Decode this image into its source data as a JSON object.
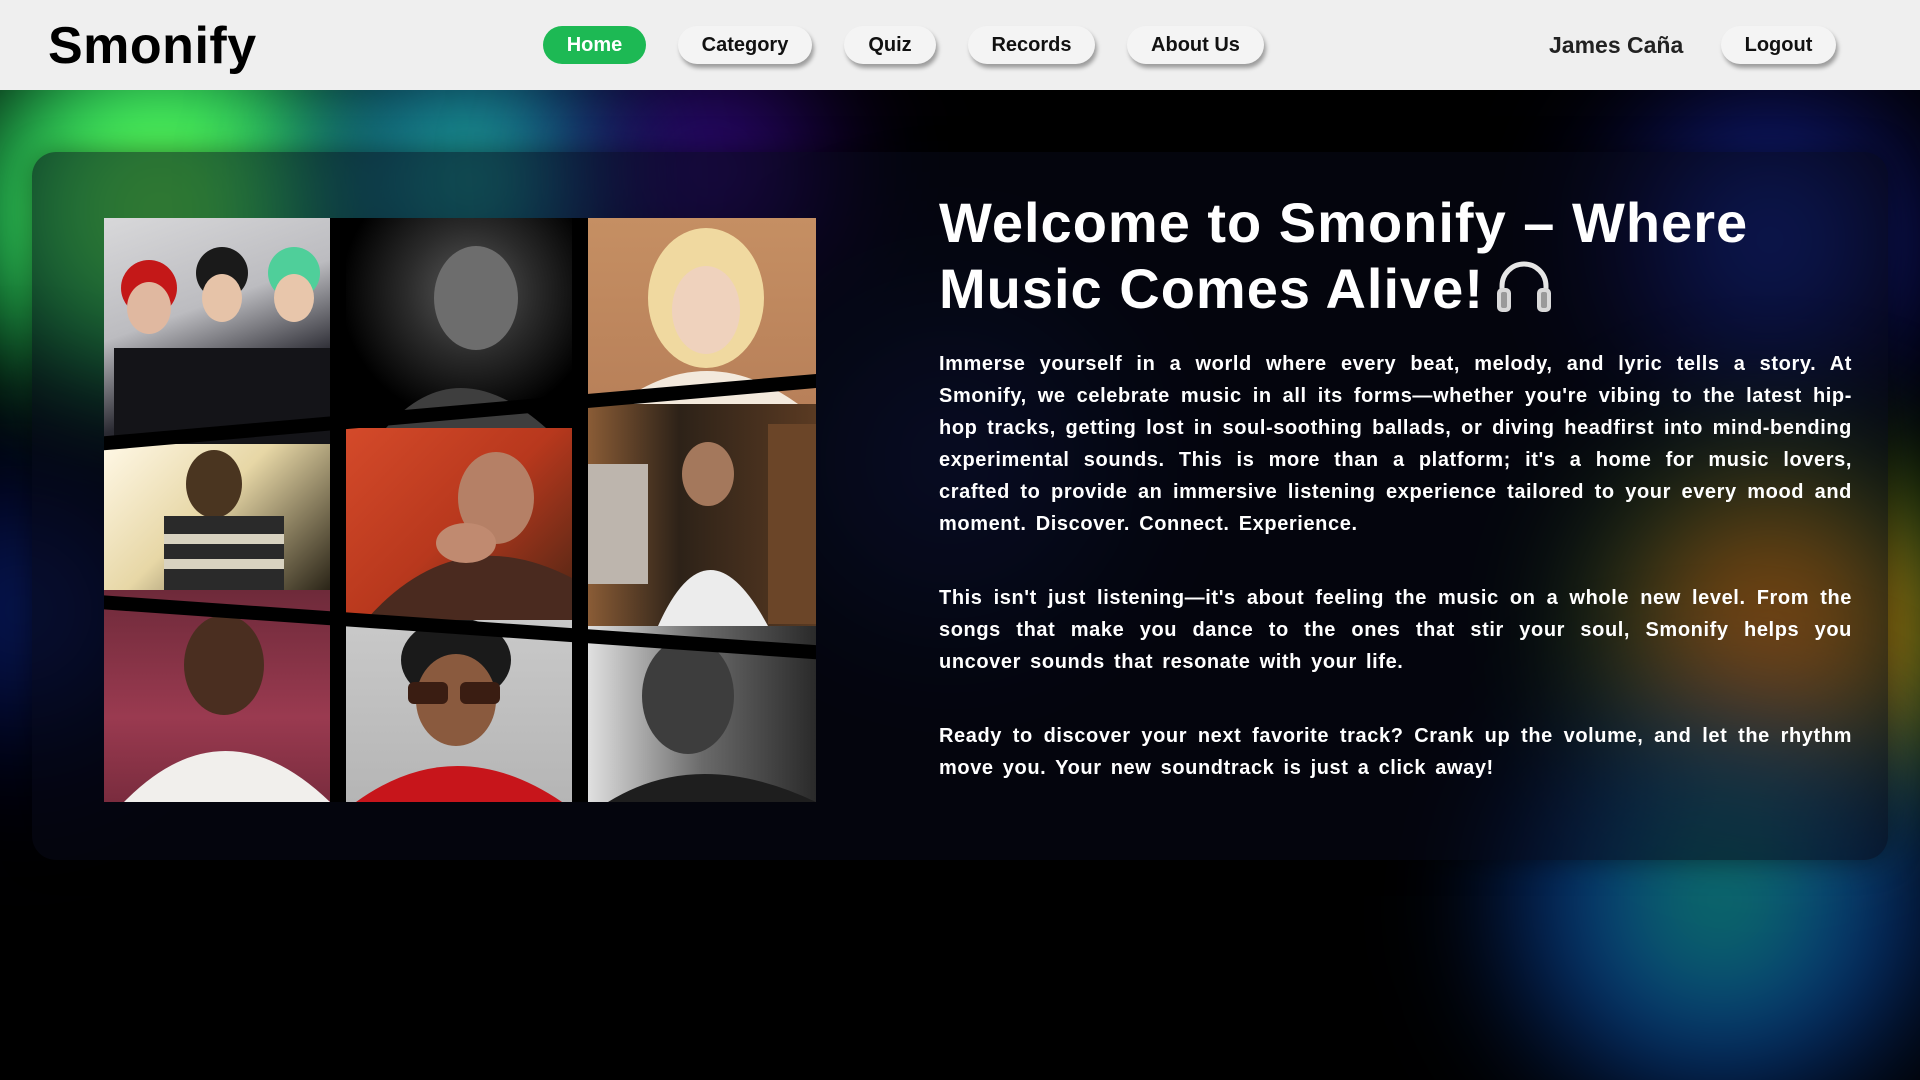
{
  "brand": {
    "logo_text": "Smonify"
  },
  "nav": {
    "items": [
      {
        "label": "Home",
        "active": true
      },
      {
        "label": "Category",
        "active": false
      },
      {
        "label": "Quiz",
        "active": false
      },
      {
        "label": "Records",
        "active": false
      },
      {
        "label": "About Us",
        "active": false
      }
    ],
    "user_name": "James Caña",
    "logout_label": "Logout"
  },
  "hero": {
    "title": "Welcome to Smonify – Where Music Comes Alive!",
    "title_icon": "headphones-icon",
    "paragraphs": [
      "Immerse yourself in a world where every beat, melody, and lyric tells a story. At Smonify, we celebrate music in all its forms—whether you're vibing to the latest hip-hop tracks, getting lost in soul-soothing ballads, or diving headfirst into mind-bending experimental sounds. This is more than a platform; it's a home for music lovers, crafted to provide an immersive listening experience tailored to your every mood and moment. Discover. Connect. Experience.",
      "This isn't just listening—it's about feeling the music on a whole new level. From the songs that make you dance to the ones that stir your soul, Smonify helps you uncover sounds that resonate with your life.",
      "Ready to discover your next favorite track? Crank up the volume, and let the rhythm move you. Your new soundtrack is just a click away!"
    ]
  },
  "collage": {
    "images": [
      {
        "name": "artist-photo-group-trio"
      },
      {
        "name": "artist-photo-bw-portrait"
      },
      {
        "name": "artist-photo-blonde-portrait"
      },
      {
        "name": "artist-photo-striped-shirt"
      },
      {
        "name": "artist-photo-red-background"
      },
      {
        "name": "artist-photo-street-white-tee"
      },
      {
        "name": "artist-photo-braids-white-sweater"
      },
      {
        "name": "artist-photo-sunglasses-red-jacket"
      },
      {
        "name": "artist-photo-bw-closeup"
      }
    ]
  },
  "colors": {
    "accent": "#1db954",
    "navbar_bg": "#efefef",
    "page_bg": "#000000",
    "text_light": "#ffffff"
  }
}
